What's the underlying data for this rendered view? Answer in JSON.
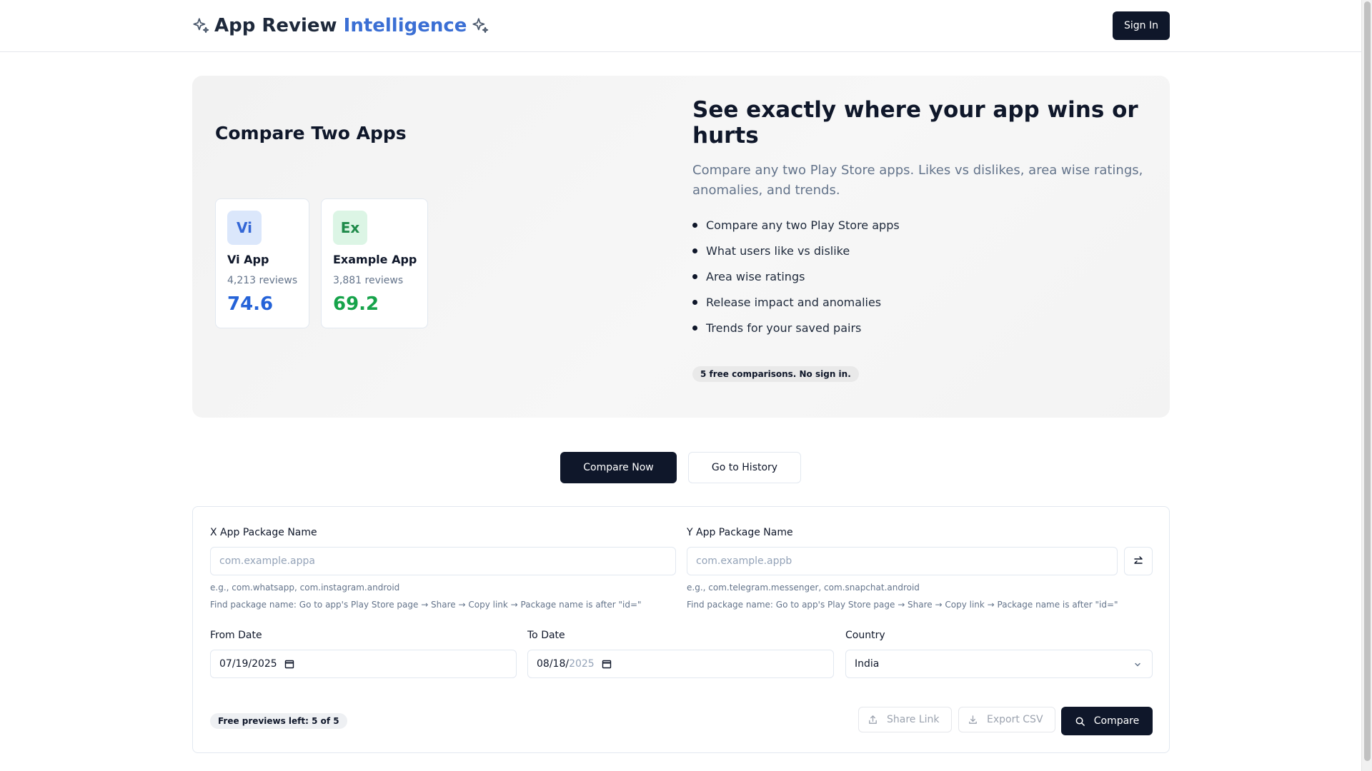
{
  "header": {
    "title_main": "App Review",
    "title_accent": "Intelligence",
    "signin_label": "Sign In"
  },
  "hero": {
    "left_title": "Compare Two Apps",
    "apps": [
      {
        "badge": "Vi",
        "name": "Vi App",
        "reviews": "4,213 reviews",
        "score": "74.6",
        "color": "#2563d8"
      },
      {
        "badge": "Ex",
        "name": "Example App",
        "reviews": "3,881 reviews",
        "score": "69.2",
        "color": "#16a34a"
      }
    ],
    "headline": "See exactly where your app wins or hurts",
    "subtitle": "Compare any two Play Store apps. Likes vs dislikes, area wise ratings, anomalies, and trends.",
    "bullets": [
      "Compare any two Play Store apps",
      "What users like vs dislike",
      "Area wise ratings",
      "Release impact and anomalies",
      "Trends for your saved pairs"
    ],
    "free_note": "5 free comparisons. No sign in."
  },
  "actions": {
    "compare_now": "Compare Now",
    "history": "Go to History"
  },
  "form": {
    "x_label": "X App Package Name",
    "x_placeholder": "com.example.appa",
    "x_example": "e.g., com.whatsapp, com.instagram.android",
    "y_label": "Y App Package Name",
    "y_placeholder": "com.example.appb",
    "y_example": "e.g., com.telegram.messenger, com.snapchat.android",
    "find_hint": "Find package name: Go to app's Play Store page → Share → Copy link → Package name is after \"id=\"",
    "from_label": "From Date",
    "from_value": "07/19/2025",
    "to_label": "To Date",
    "to_value_main": "08/18/",
    "to_value_dim": "2025",
    "country_label": "Country",
    "country_value": "India",
    "previews_left": "Free previews left: 5 of 5",
    "share_label": "Share Link",
    "export_label": "Export CSV",
    "compare_label": "Compare"
  }
}
